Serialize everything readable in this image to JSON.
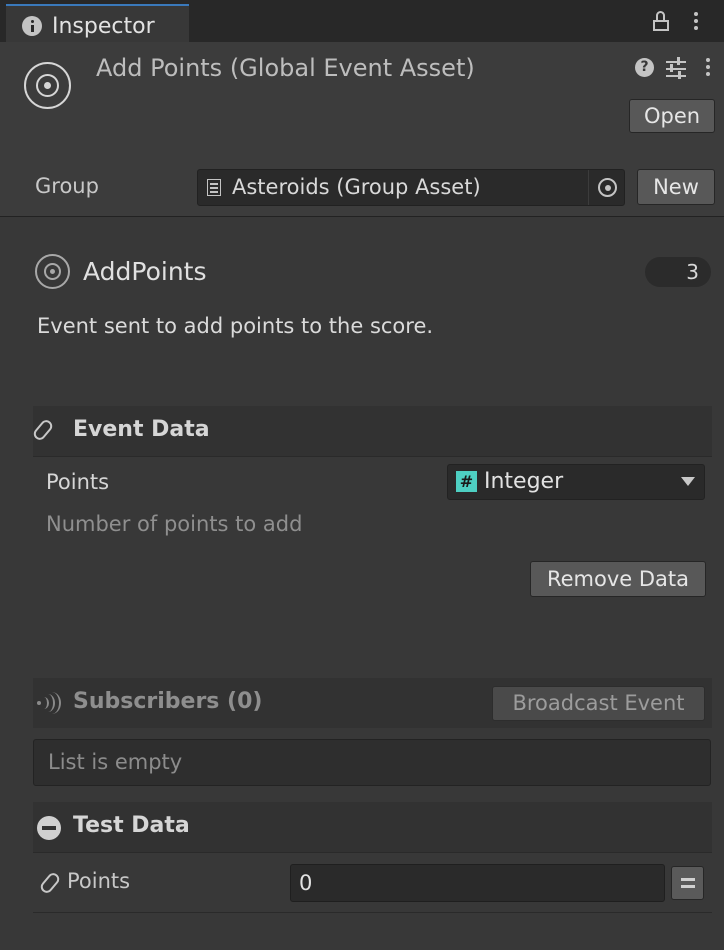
{
  "tab": {
    "title": "Inspector"
  },
  "header": {
    "asset_title": "Add Points (Global Event Asset)",
    "help_glyph": "?",
    "open_label": "Open",
    "group_label": "Group",
    "group_value": "Asteroids (Group Asset)",
    "new_label": "New"
  },
  "event": {
    "name": "AddPoints",
    "count": "3",
    "description": "Event sent to add points to the score."
  },
  "event_data": {
    "title": "Event Data",
    "field_label": "Points",
    "type_glyph": "#",
    "type_value": "Integer",
    "field_description": "Number of points to add",
    "remove_label": "Remove Data"
  },
  "subscribers": {
    "title": "Subscribers (0)",
    "broadcast_label": "Broadcast Event",
    "empty_text": "List is empty"
  },
  "test_data": {
    "title": "Test Data",
    "field_label": "Points",
    "field_value": "0"
  },
  "colors": {
    "background": "#383838",
    "tab_accent": "#3a79bb",
    "integer_badge": "#4ecfc2"
  },
  "icons": [
    "info-icon",
    "lock-icon",
    "kebab-icon",
    "target-icon",
    "help-icon",
    "sliders-icon",
    "list-icon",
    "object-picker-icon",
    "paperclip-icon",
    "dropdown-caret-icon",
    "signal-icon",
    "minus-circle-icon",
    "equals-icon"
  ]
}
